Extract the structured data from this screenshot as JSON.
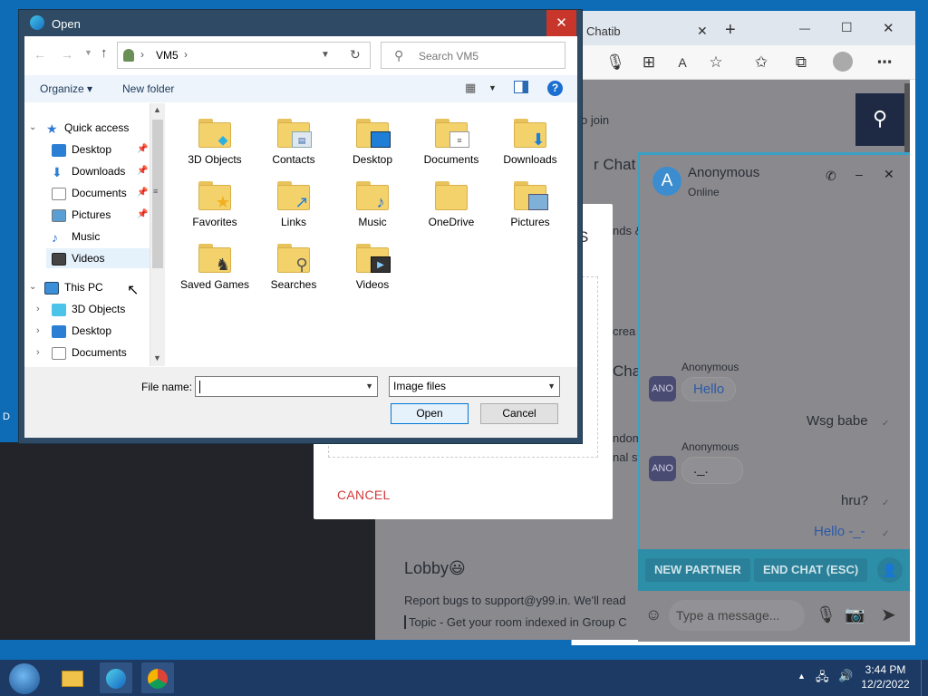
{
  "browser": {
    "tab_title": "Chatib",
    "tab_close": "✕",
    "new_tab": "+",
    "win_min": "—",
    "win_max": "☐",
    "win_close": "✕",
    "toolbar_icons": [
      "mic-icon",
      "extensions-icon",
      "read-aloud-icon",
      "add-favorite-icon",
      "favorites-icon",
      "collections-icon",
      "profile-icon",
      "more-icon"
    ]
  },
  "page": {
    "join_text": "o join",
    "heading_partial": "r Chat R",
    "line_nds": "nds &",
    "line_s": "S",
    "line_crea": "crea",
    "line_chat": "Chat",
    "line_ndom": "ndom",
    "line_nal": "nal st",
    "lobby_label": "Lobby😃",
    "report_text": "Report bugs to support@y99.in. We'll read",
    "topic_text": "Topic - Get your room indexed in Group C",
    "left_edge_letter": "D"
  },
  "modal": {
    "cancel_label": "CANCEL"
  },
  "chat": {
    "avatar_letter": "A",
    "partner_name": "Anonymous",
    "status": "Online",
    "messages": [
      {
        "sender": "Anonymous",
        "text": "Hello",
        "side": "left",
        "avatar": "ANO"
      },
      {
        "text": "Wsg babe",
        "side": "right"
      },
      {
        "sender": "Anonymous",
        "text": "._.",
        "side": "left",
        "avatar": "ANO"
      },
      {
        "text": "hru?",
        "side": "right"
      },
      {
        "text": "Hello -_-",
        "side": "right"
      }
    ],
    "new_partner_label": "NEW PARTNER",
    "end_chat_label": "END CHAT (ESC)",
    "input_placeholder": "Type a message..."
  },
  "dialog": {
    "title": "Open",
    "close_label": "✕",
    "address_path": "VM5",
    "search_placeholder": "Search VM5",
    "organize_label": "Organize ▾",
    "new_folder_label": "New folder",
    "help_label": "?",
    "nav": {
      "quick_access": "Quick access",
      "quick_items": [
        {
          "label": "Desktop",
          "pinned": true
        },
        {
          "label": "Downloads",
          "pinned": true
        },
        {
          "label": "Documents",
          "pinned": true
        },
        {
          "label": "Pictures",
          "pinned": true
        },
        {
          "label": "Music",
          "pinned": false
        },
        {
          "label": "Videos",
          "pinned": false
        }
      ],
      "this_pc": "This PC",
      "pc_items": [
        "3D Objects",
        "Desktop",
        "Documents"
      ]
    },
    "folders": [
      "3D Objects",
      "Contacts",
      "Desktop",
      "Documents",
      "Downloads",
      "Favorites",
      "Links",
      "Music",
      "OneDrive",
      "Pictures",
      "Saved Games",
      "Searches",
      "Videos"
    ],
    "file_name_label": "File name:",
    "file_name_value": "",
    "file_type_value": "Image files",
    "open_label": "Open",
    "cancel_label": "Cancel"
  },
  "taskbar": {
    "time": "3:44 PM",
    "date": "12/2/2022",
    "apps": [
      "start-button",
      "file-explorer-icon",
      "edge-icon",
      "chrome-icon"
    ]
  }
}
